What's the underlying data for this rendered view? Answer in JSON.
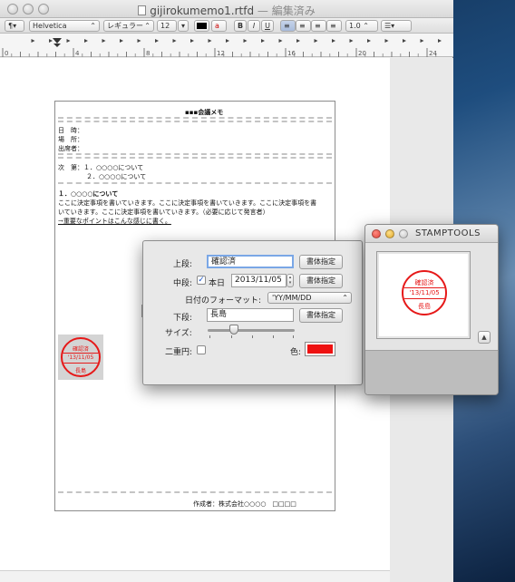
{
  "window": {
    "title": "gijirokumemo1.rtfd",
    "status": "— 編集済み"
  },
  "format_bar": {
    "paragraph_style": "¶▾",
    "font_family": "Helvetica",
    "font_style": "レギュラー",
    "font_size": "12",
    "bold": "B",
    "italic": "I",
    "underline": "U",
    "line_spacing": "1.0",
    "list": "☰▾",
    "text_color": "#000000"
  },
  "ruler": {
    "labels": [
      "0",
      "4",
      "8",
      "12",
      "16",
      "20",
      "24"
    ]
  },
  "document": {
    "heading": "▪▪▪会議メモ",
    "date_label": "日　時：",
    "place_label": "場　所：",
    "attendees_label": "出席者：",
    "agenda_label": "次　第：１．○○○○について",
    "agenda_item2": "２．○○○○について",
    "section1_title": "１．○○○○について",
    "body_line1": "ここに決定事項を書いていきます。ここに決定事項を書いていきます。ここに決定事項を書",
    "body_line2": "いていきます。ここに決定事項を書いていきます。（必要に応じて発言者）",
    "body_line3": "→重要なポイントはこんな感じに書く。",
    "footer": "作成者：株式会社○○○○　□□□□"
  },
  "stamp": {
    "top": "確認済",
    "middle": "'13/11/05",
    "bottom": "長島",
    "color": "#e61919"
  },
  "panel": {
    "top_label": "上段:",
    "top_value": "確認済",
    "font_button": "書体指定",
    "middle_label": "中段:",
    "today_label": "本日",
    "today_checked": true,
    "middle_value": "2013/11/05",
    "date_format_label": "日付のフォーマット:",
    "date_format_value": "'YY/MM/DD",
    "bottom_label": "下段:",
    "bottom_value": "長島",
    "size_label": "サイズ:",
    "size_value": 0.3,
    "double_circle_label": "二重円:",
    "double_circle_checked": false,
    "color_label": "色:",
    "color_value": "#ee1111"
  },
  "stamptools": {
    "title": "STAMPTOOLS",
    "toggle_icon": "▲"
  }
}
